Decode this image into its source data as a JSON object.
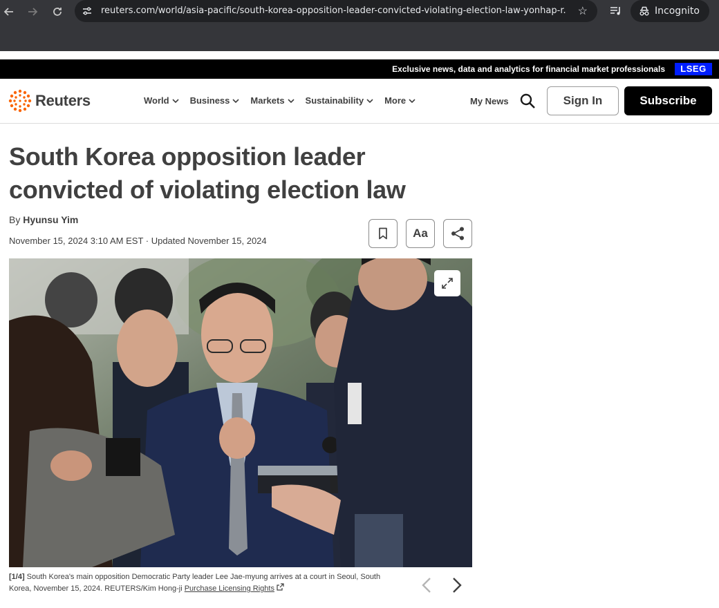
{
  "browser": {
    "url": "reuters.com/world/asia-pacific/south-korea-opposition-leader-convicted-violating-election-law-yonhap-r...",
    "profile_label": "Incognito",
    "icons": [
      "back-arrow-icon",
      "forward-arrow-icon",
      "reload-icon",
      "site-settings-icon",
      "bookmark-star-icon",
      "reading-list-icon",
      "incognito-icon"
    ]
  },
  "banner": {
    "text": "Exclusive news, data and analytics for financial market professionals",
    "brand": "LSEG",
    "brand_color": "#001eff"
  },
  "header": {
    "logo_text": "Reuters",
    "logo_color": "#fa6400",
    "nav": [
      {
        "label": "World"
      },
      {
        "label": "Business"
      },
      {
        "label": "Markets"
      },
      {
        "label": "Sustainability"
      },
      {
        "label": "More"
      }
    ],
    "my_news": "My News",
    "sign_in": "Sign In",
    "subscribe": "Subscribe"
  },
  "article": {
    "headline_line1": "South Korea opposition leader",
    "headline_line2": "convicted of violating election law",
    "by_prefix": "By ",
    "author": "Hyunsu Yim",
    "dateline": "November 15, 2024 3:10 AM EST · Updated November 15, 2024",
    "text_size_label": "Aa"
  },
  "gallery": {
    "count": "[1/4]",
    "caption": " South Korea's main opposition Democratic Party leader Lee Jae-myung arrives at a court in Seoul, South Korea, November 15, 2024. REUTERS/Kim Hong-ji ",
    "license_link": "Purchase Licensing Rights"
  }
}
